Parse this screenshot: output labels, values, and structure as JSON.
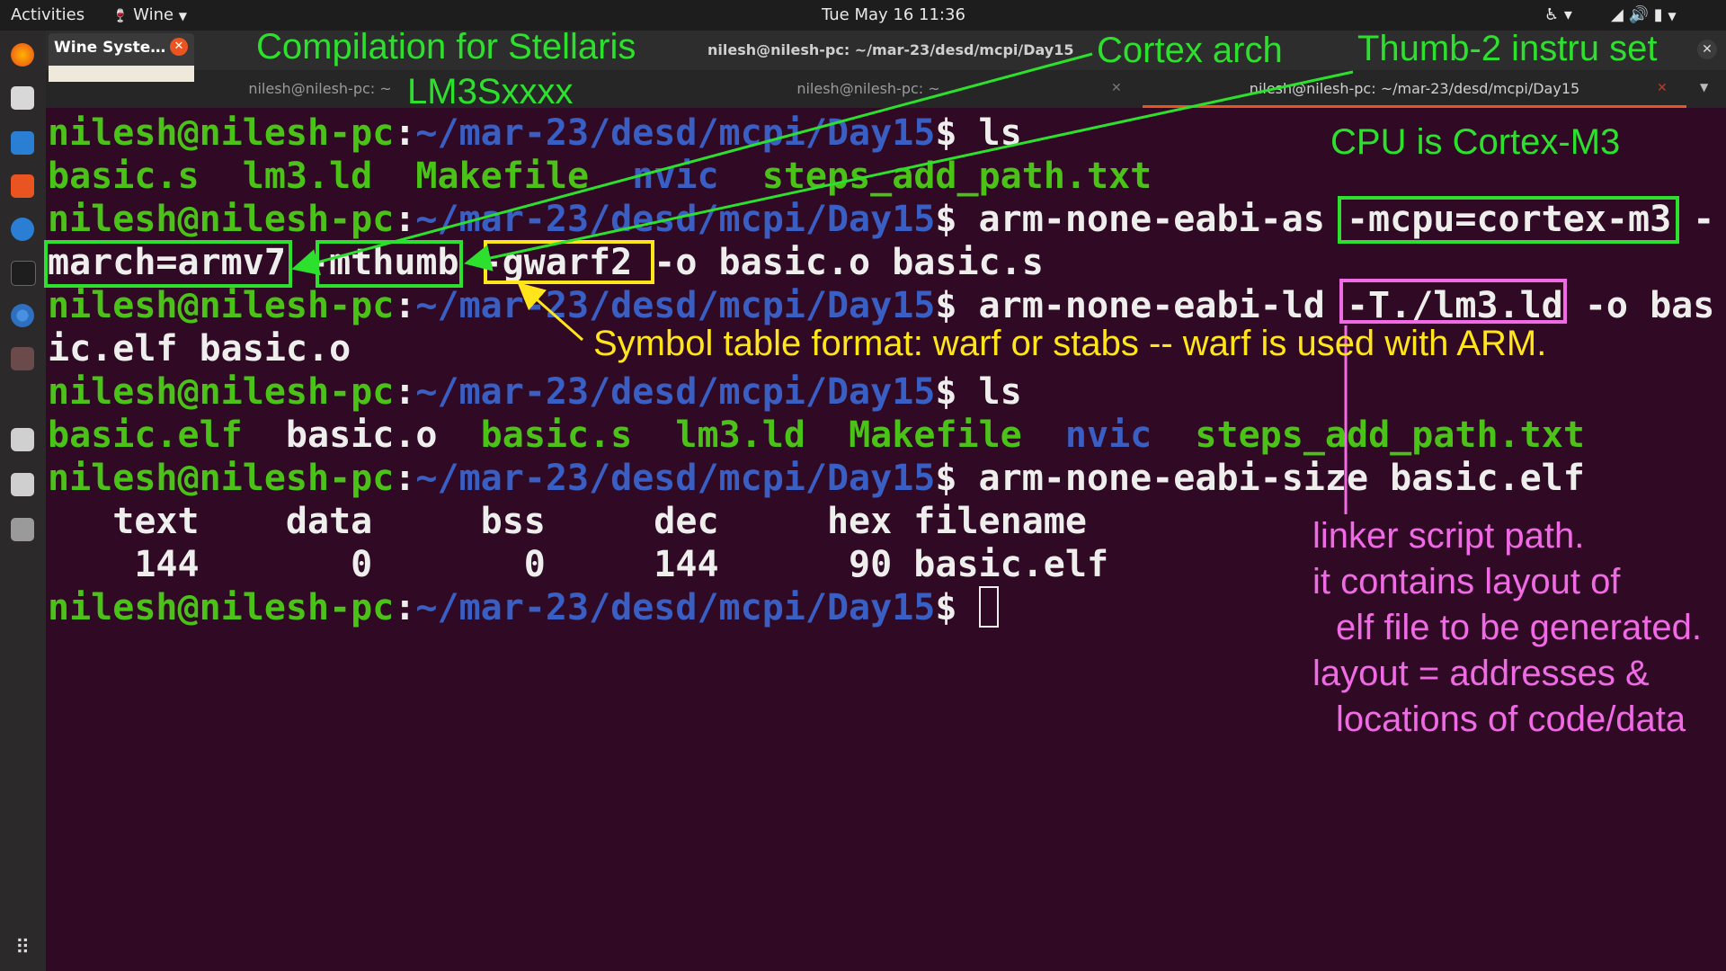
{
  "topbar": {
    "activities": "Activities",
    "app_menu": "Wine",
    "clock": "Tue May 16  11:36"
  },
  "notification": {
    "title": "Wine Syste…"
  },
  "window": {
    "title": "nilesh@nilesh-pc: ~/mar-23/desd/mcpi/Day15",
    "tabs": [
      {
        "label": "nilesh@nilesh-pc: ~"
      },
      {
        "label": "nilesh@nilesh-pc: ~"
      },
      {
        "label": "nilesh@nilesh-pc: ~/mar-23/desd/mcpi/Day15"
      }
    ]
  },
  "terminal": {
    "prompt_user": "nilesh@nilesh-pc",
    "prompt_colon": ":",
    "prompt_path": "~/mar-23/desd/mcpi/Day15",
    "prompt_dollar": "$",
    "cmd1": " ls",
    "ls1": {
      "basic_s": "basic.s",
      "lm3_ld": "lm3.ld",
      "makefile": "Makefile",
      "nvic": "nvic",
      "steps": "steps_add_path.txt"
    },
    "cmd2_line1": " arm-none-eabi-as -mcpu=cortex-m3 -",
    "cmd2_line2": "march=armv7 -mthumb -gwarf2 -o basic.o basic.s",
    "cmd3_line1": " arm-none-eabi-ld -T./lm3.ld -o bas",
    "cmd3_line2": "ic.elf basic.o",
    "cmd4": " ls",
    "ls2": {
      "basic_elf": "basic.elf",
      "basic_o": "basic.o",
      "basic_s": "basic.s",
      "lm3_ld": "lm3.ld",
      "makefile": "Makefile",
      "nvic": "nvic",
      "steps": "steps_add_path.txt"
    },
    "cmd5": " arm-none-eabi-size basic.elf",
    "size_header": "   text    data     bss     dec     hex filename",
    "size_row": "    144       0       0     144      90 basic.elf"
  },
  "annotations": {
    "compilation_line1": "Compilation for Stellaris",
    "compilation_line2": "LM3Sxxxx",
    "cortex_arch": "Cortex arch",
    "thumb2": "Thumb-2 instru set",
    "cpu": "CPU is Cortex-M3",
    "symbol_table": "Symbol table format: warf or stabs -- warf is used with ARM.",
    "linker1": "linker script path.",
    "linker2": "it contains layout of",
    "linker3": "elf file to be generated.",
    "linker4": "layout = addresses &",
    "linker5": "locations of code/data"
  },
  "colors": {
    "terminal_bg": "#300a24",
    "prompt_green": "#4bc217",
    "path_blue": "#3a5fc4",
    "annotation_green": "#2ee02e",
    "annotation_yellow": "#ffe51a",
    "annotation_pink": "#f06ae6"
  },
  "icons": [
    "firefox-icon",
    "files-icon",
    "writer-icon",
    "software-icon",
    "help-icon",
    "terminal-icon",
    "chrome-icon",
    "wine-icon",
    "camera-icon",
    "display-icon",
    "ssd-icon",
    "apps-grid-icon"
  ]
}
